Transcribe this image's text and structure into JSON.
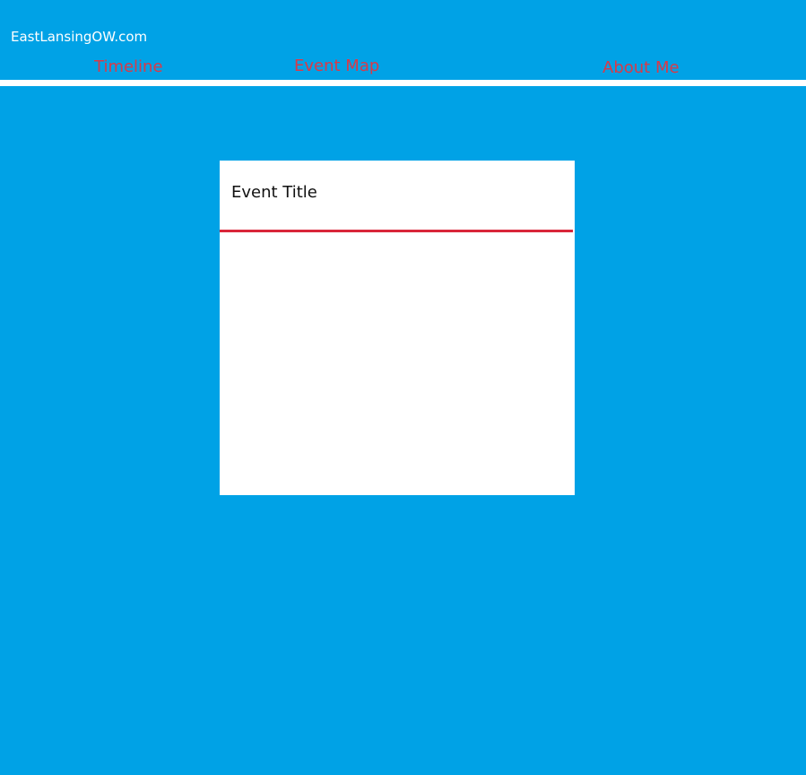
{
  "header": {
    "site_title": "EastLansingOW.com"
  },
  "nav": {
    "items": [
      {
        "label": "Timeline"
      },
      {
        "label": "Event Map"
      },
      {
        "label": "About Me"
      }
    ]
  },
  "event_card": {
    "title": "Event Title"
  },
  "colors": {
    "background": "#00a2e6",
    "nav_link": "#d93a48",
    "card_rule": "#d9263a",
    "divider": "#ffffff"
  }
}
